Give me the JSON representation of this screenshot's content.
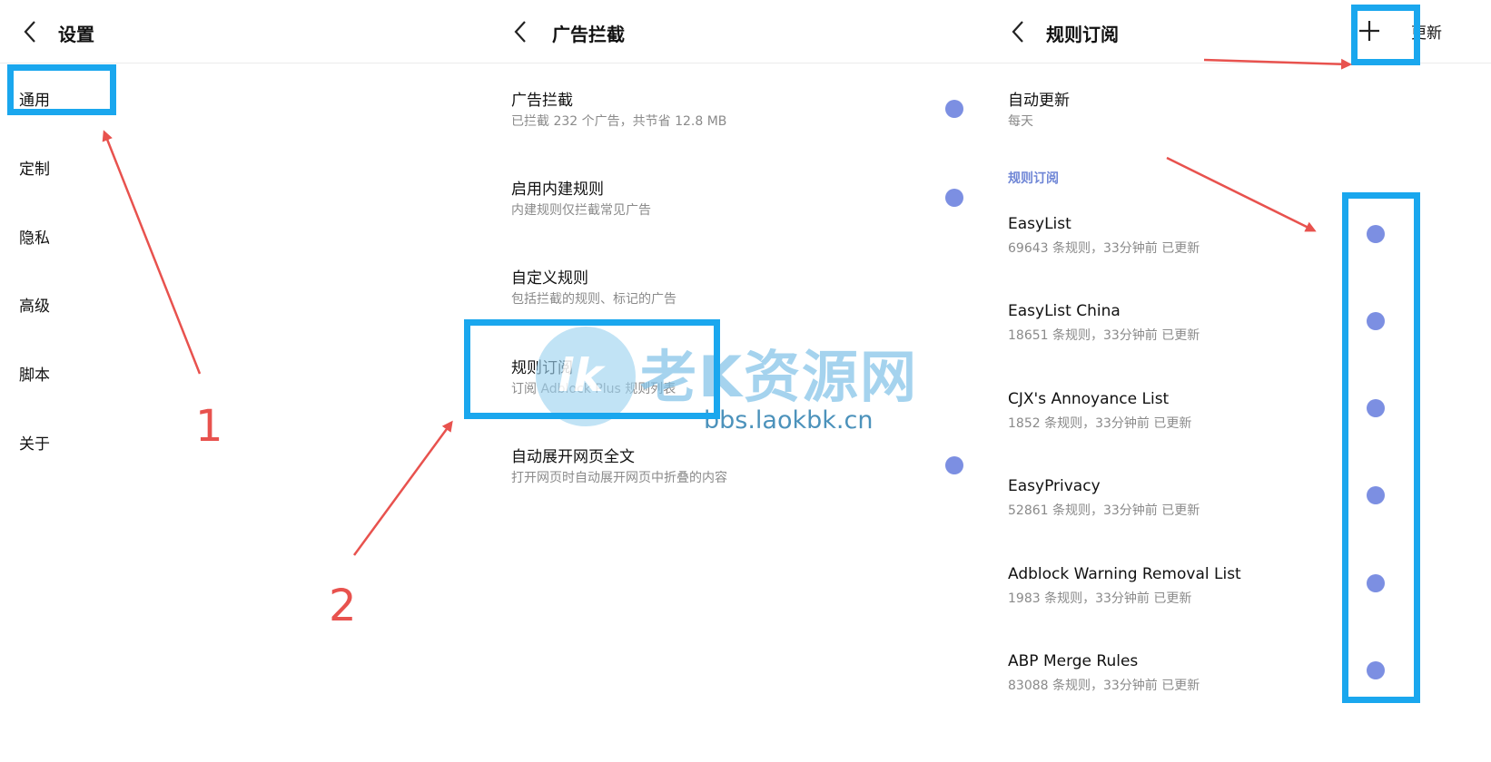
{
  "settings": {
    "title": "设置",
    "items": [
      "通用",
      "定制",
      "隐私",
      "高级",
      "脚本",
      "关于"
    ]
  },
  "adblock": {
    "title": "广告拦截",
    "rows": [
      {
        "title": "广告拦截",
        "sub": "已拦截 232 个广告，共节省 12.8 MB",
        "toggle": true
      },
      {
        "title": "启用内建规则",
        "sub": "内建规则仅拦截常见广告",
        "toggle": true
      },
      {
        "title": "自定义规则",
        "sub": "包括拦截的规则、标记的广告",
        "toggle": false
      },
      {
        "title": "规则订阅",
        "sub": "订阅 Adblock Plus 规则列表",
        "toggle": false
      },
      {
        "title": "自动展开网页全文",
        "sub": "打开网页时自动展开网页中折叠的内容",
        "toggle": true
      }
    ]
  },
  "subscriptions": {
    "title": "规则订阅",
    "update_label": "更新",
    "auto_update": {
      "title": "自动更新",
      "sub": "每天"
    },
    "section_label": "规则订阅",
    "lists": [
      {
        "name": "EasyList",
        "meta": "69643 条规则，33分钟前 已更新"
      },
      {
        "name": "EasyList China",
        "meta": "18651 条规则，33分钟前 已更新"
      },
      {
        "name": "CJX's Annoyance List",
        "meta": "1852 条规则，33分钟前 已更新"
      },
      {
        "name": "EasyPrivacy",
        "meta": "52861 条规则，33分钟前 已更新"
      },
      {
        "name": "Adblock Warning Removal List",
        "meta": "1983 条规则，33分钟前 已更新"
      },
      {
        "name": "ABP Merge Rules",
        "meta": "83088 条规则，33分钟前 已更新"
      }
    ]
  },
  "annotations": {
    "step1": "1",
    "step2": "2"
  },
  "watermark": {
    "logo": "lk",
    "title": "老K资源网",
    "url": "bbs.laokbk.cn"
  },
  "colors": {
    "toggle": "#7c8fe2",
    "highlight": "#1aa7ee",
    "arrow": "#e8524e",
    "section": "#6f86d6"
  }
}
